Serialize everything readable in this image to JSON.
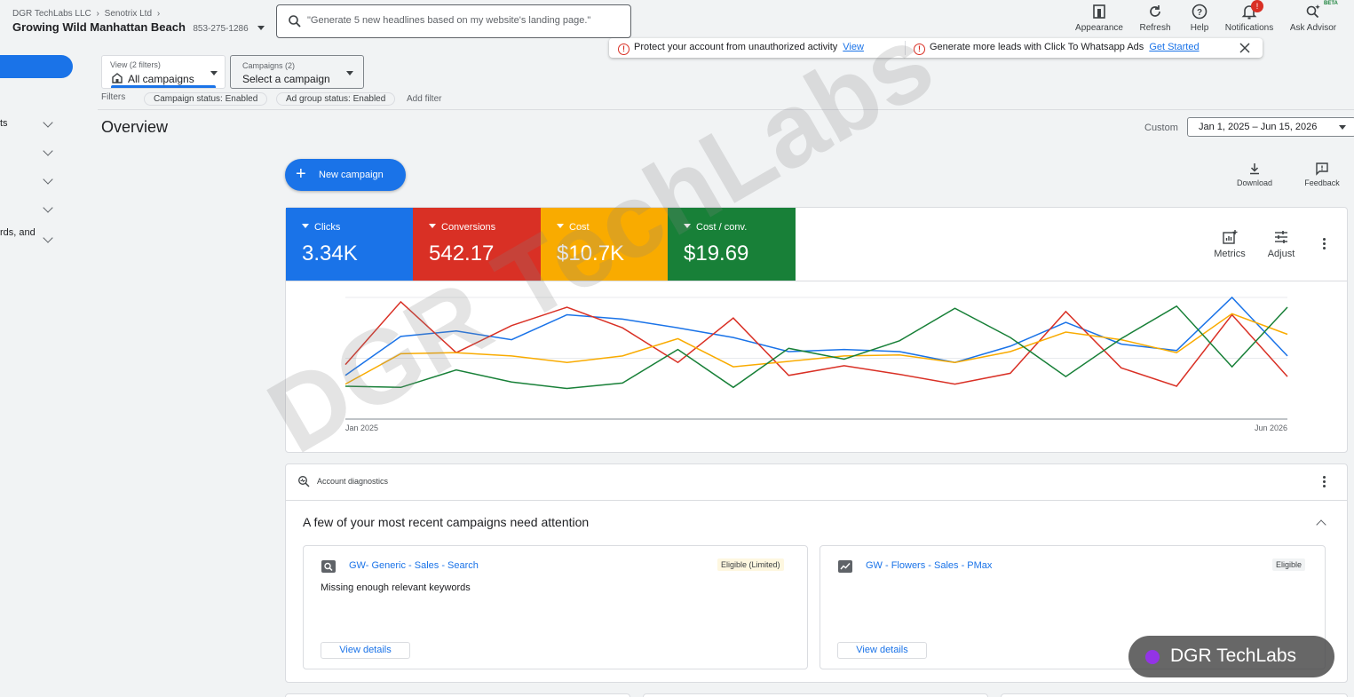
{
  "header": {
    "breadcrumb": [
      "DGR TechLabs LLC",
      "Senotrix Ltd"
    ],
    "account_name": "Growing Wild Manhattan Beach",
    "account_id": "853-275-1286",
    "search_placeholder": "\"Generate 5 new headlines based on my website's landing page.\"",
    "tools": {
      "appearance": "Appearance",
      "refresh": "Refresh",
      "help": "Help",
      "notifications": "Notifications",
      "notifications_badge": "!",
      "ask_advisor": "Ask Advisor",
      "beta": "BETA"
    }
  },
  "banner": {
    "msg1": "Protect your account from unauthorized activity",
    "link1": "View",
    "msg2": "Generate more leads with Click To Whatsapp Ads",
    "link2": "Get Started"
  },
  "sidebar": {
    "items": [
      "ts",
      "",
      "",
      "",
      "rds, and"
    ]
  },
  "filters": {
    "view_label": "View (2 filters)",
    "view_value": "All campaigns",
    "campaigns_label": "Campaigns (2)",
    "campaigns_value": "Select a campaign",
    "filters_label": "Filters",
    "chips": [
      "Campaign status: Enabled",
      "Ad group status: Enabled"
    ],
    "add_filter": "Add filter"
  },
  "overview": {
    "title": "Overview",
    "custom_label": "Custom",
    "date_range": "Jan 1, 2025 – Jun 15, 2026",
    "new_campaign": "New campaign",
    "download": "Download",
    "feedback": "Feedback"
  },
  "metrics": {
    "tiles": [
      {
        "name": "Clicks",
        "value": "3.34K",
        "color": "#1a73e8"
      },
      {
        "name": "Conversions",
        "value": "542.17",
        "color": "#d93025"
      },
      {
        "name": "Cost",
        "value": "$10.7K",
        "color": "#f9ab00"
      },
      {
        "name": "Cost / conv.",
        "value": "$19.69",
        "color": "#188038"
      }
    ],
    "metrics_btn": "Metrics",
    "adjust_btn": "Adjust"
  },
  "chart_data": {
    "type": "line",
    "x_start_label": "Jan 2025",
    "x_end_label": "Jun 2026",
    "grid": true,
    "legend": "none",
    "series": [
      {
        "color": "#1a73e8",
        "values": [
          28,
          64,
          69,
          61,
          84,
          80,
          72,
          63,
          50,
          52,
          50,
          40,
          55,
          77,
          57,
          51,
          100,
          46
        ]
      },
      {
        "color": "#d93025",
        "values": [
          38,
          96,
          49,
          74,
          91,
          72,
          40,
          81,
          28,
          37,
          29,
          20,
          30,
          87,
          35,
          18,
          84,
          27
        ]
      },
      {
        "color": "#f9ab00",
        "values": [
          20,
          48,
          49,
          46,
          40,
          46,
          62,
          36,
          41,
          46,
          47,
          40,
          50,
          68,
          61,
          49,
          85,
          66
        ]
      },
      {
        "color": "#188038",
        "values": [
          18,
          17,
          33,
          22,
          16,
          21,
          52,
          17,
          53,
          43,
          60,
          90,
          63,
          27,
          62,
          92,
          36,
          91
        ]
      }
    ]
  },
  "diagnostics": {
    "header": "Account diagnostics",
    "title": "A few of your most recent campaigns need attention",
    "campaigns": [
      {
        "name": "GW- Generic - Sales - Search",
        "status": "Eligible (Limited)",
        "status_bg": "#fef7e0",
        "issue": "Missing enough relevant keywords",
        "button": "View details"
      },
      {
        "name": "GW - Flowers - Sales - PMax",
        "status": "Eligible",
        "status_bg": "#f1f3f4",
        "issue": "",
        "button": "View details"
      }
    ]
  },
  "watermark": {
    "text": "DGR TechLabs",
    "brand": "DGR TechLabs"
  }
}
